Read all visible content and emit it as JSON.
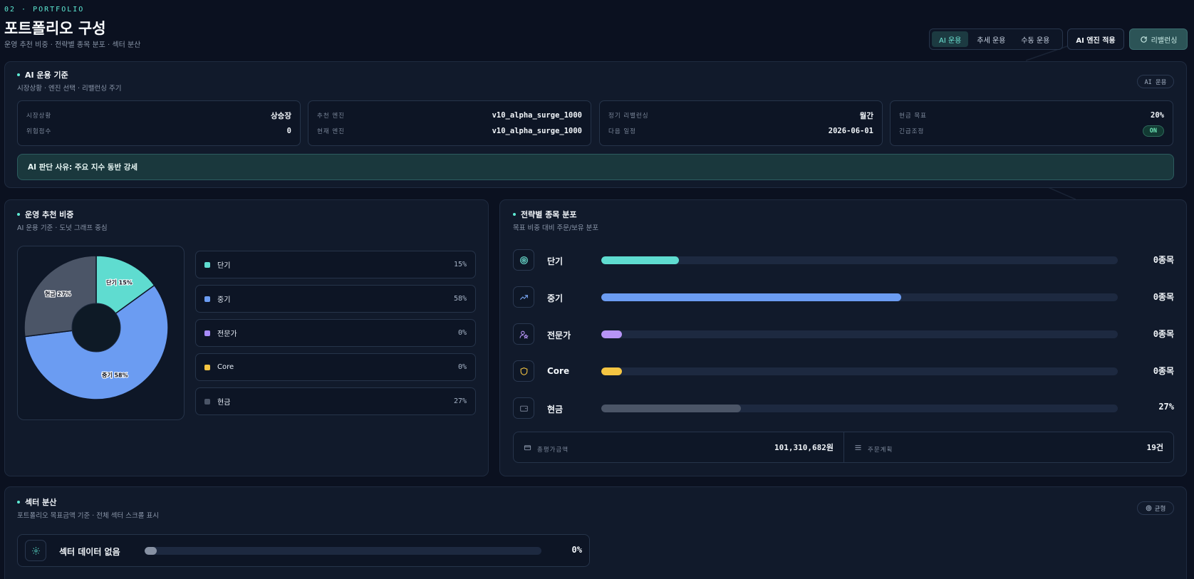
{
  "header": {
    "kicker": "02 · PORTFOLIO",
    "title": "포트폴리오 구성",
    "subtitle": "운영 추천 비중 · 전략별 종목 분포 · 섹터 분산",
    "modes": [
      "AI 운용",
      "추세 운용",
      "수동 운용"
    ],
    "active_mode": "AI 운용",
    "engine_btn": "AI 엔진 적용",
    "rebalance_btn": "리밸런싱"
  },
  "ai_basis": {
    "title": "AI 운용 기준",
    "subtitle": "시장상황 · 엔진 선택 · 리밸런싱 주기",
    "badge": "AI 운용",
    "cards": [
      {
        "k1": "시장상황",
        "v1": "상승장",
        "k2": "위험점수",
        "v2": "0"
      },
      {
        "k1": "추천 엔진",
        "v1": "v10_alpha_surge_1000",
        "k2": "현재 엔진",
        "v2": "v10_alpha_surge_1000"
      },
      {
        "k1": "정기 리밸런싱",
        "v1": "월간",
        "k2": "다음 일정",
        "v2": "2026-06-01"
      },
      {
        "k1": "현금 목표",
        "v1": "20%",
        "k2": "긴급조정",
        "v2": "ON"
      }
    ],
    "reason": "AI 판단 사유: 주요 지수 동반 강세"
  },
  "allocation": {
    "title": "운영 추천 비중",
    "subtitle": "AI 운용 기준 · 도넛 그래프 중심",
    "legend": [
      {
        "label": "단기",
        "pct": "15%",
        "color": "#5fdcd0"
      },
      {
        "label": "중기",
        "pct": "58%",
        "color": "#6b9cf2"
      },
      {
        "label": "전문가",
        "pct": "0%",
        "color": "#a78bfa"
      },
      {
        "label": "Core",
        "pct": "0%",
        "color": "#f5c542"
      },
      {
        "label": "현금",
        "pct": "27%",
        "color": "#4b5567"
      }
    ],
    "slice_labels": [
      "단기 15%",
      "중기 58%",
      "현금 27%"
    ]
  },
  "chart_data": {
    "type": "pie",
    "categories": [
      "단기",
      "중기",
      "전문가",
      "Core",
      "현금"
    ],
    "values": [
      15,
      58,
      0,
      0,
      27
    ],
    "colors": [
      "#5fdcd0",
      "#6b9cf2",
      "#a78bfa",
      "#f5c542",
      "#4b5567"
    ]
  },
  "strategy": {
    "title": "전략별 종목 분포",
    "subtitle": "목표 비중 대비 주문/보유 분포",
    "rows": [
      {
        "icon": "target-icon",
        "label": "단기",
        "count": "0종목",
        "fill": 0.15,
        "color": "#5fdcd0"
      },
      {
        "icon": "trending-up-icon",
        "label": "중기",
        "count": "0종목",
        "fill": 0.58,
        "color": "#6b9cf2"
      },
      {
        "icon": "user-star-icon",
        "label": "전문가",
        "count": "0종목",
        "fill": 0.04,
        "color": "#b794f6"
      },
      {
        "icon": "shield-icon",
        "label": "Core",
        "count": "0종목",
        "fill": 0.04,
        "color": "#f5c542"
      },
      {
        "icon": "wallet-icon",
        "label": "현금",
        "count": "27%",
        "fill": 0.27,
        "color": "#4b5567"
      }
    ],
    "summary": [
      {
        "k": "총평가금액",
        "v": "101,310,682원"
      },
      {
        "k": "주문계획",
        "v": "19건"
      }
    ]
  },
  "sector": {
    "title": "섹터 분산",
    "subtitle": "포트폴리오 목표금액 기준 · 전체 섹터 스크롤 표시",
    "badge": "균형",
    "empty_label": "섹터 데이터 없음",
    "pct": "0%",
    "fill": 0.03
  }
}
